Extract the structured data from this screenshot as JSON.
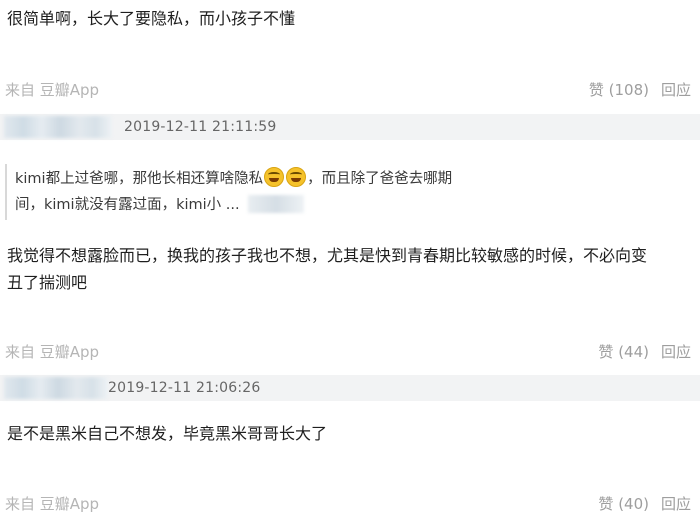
{
  "comments": [
    {
      "text_lines": [
        "很简单啊，长大了要隐私，而小孩子不懂"
      ],
      "source": "来自 豆瓣App",
      "likes_label": "赞 (108)",
      "reply_label": "回应"
    },
    {
      "timestamp": "2019-12-11 21:11:59",
      "quote": {
        "line1_before": "kimi都上过爸哪，那他长相还算啥隐私",
        "line1_after": "，而且除了爸爸去哪期",
        "line2": "间，kimi就没有露过面，kimi小 ..."
      },
      "text_lines": [
        "我觉得不想露脸而已，换我的孩子我也不想，尤其是快到青春期比较敏感的时候，不必向变",
        "丑了揣测吧"
      ],
      "source": "来自 豆瓣App",
      "likes_label": "赞 (44)",
      "reply_label": "回应"
    },
    {
      "timestamp": "2019-12-11 21:06:26",
      "text_lines": [
        "是不是黑米自己不想发，毕竟黑米哥哥长大了"
      ],
      "source": "来自 豆瓣App",
      "likes_label": "赞 (40)",
      "reply_label": "回应"
    }
  ],
  "icons": {
    "emoji": "laughing-face-icon"
  }
}
